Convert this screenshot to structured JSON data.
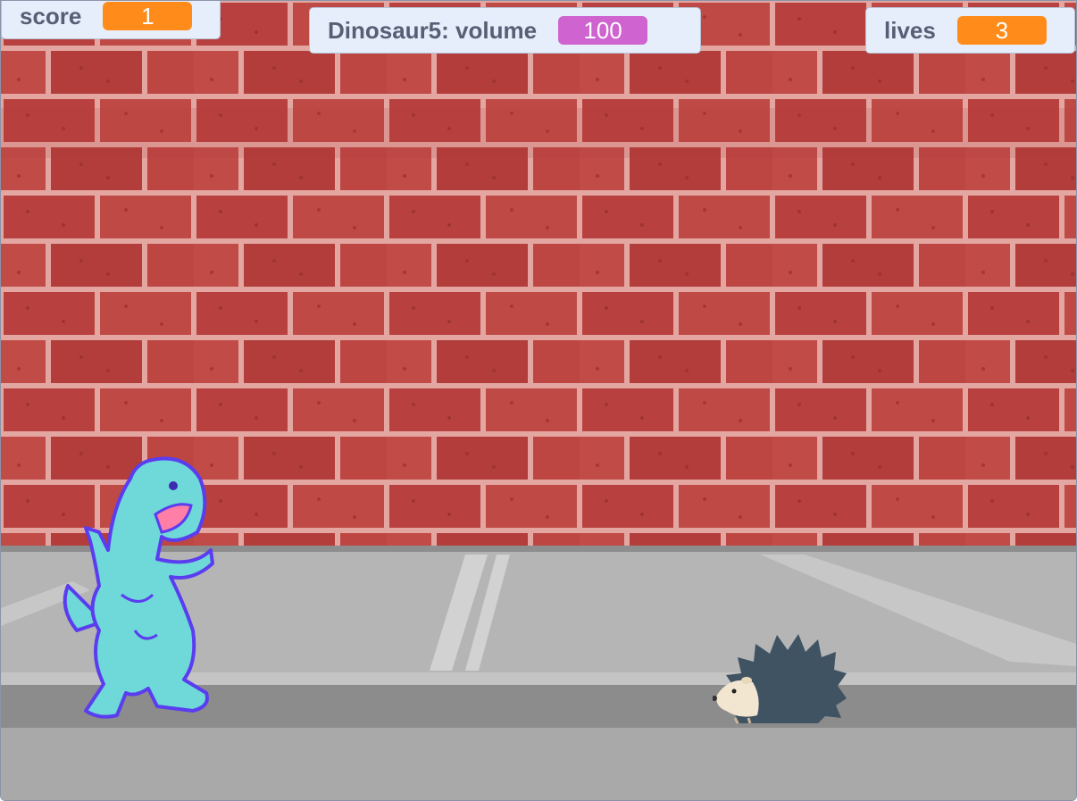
{
  "monitors": {
    "score": {
      "label": "score",
      "value": "1",
      "color": "#ff8c1a"
    },
    "volume": {
      "label": "Dinosaur5: volume",
      "value": "100",
      "color": "#cf63cf"
    },
    "lives": {
      "label": "lives",
      "value": "3",
      "color": "#ff8c1a"
    }
  },
  "colors": {
    "brick": "#b8413f",
    "mortar": "#e3a6a1",
    "sidewalk": "#b4b4b4",
    "curb": "#8c8c8c",
    "street": "#a9a9a9",
    "dinosaur": "#6fd8d8",
    "dinosaur_outline": "#5b3df0",
    "hedgehog": "#3f5363"
  },
  "sprites": {
    "dinosaur": "dinosaur-sprite",
    "hedgehog": "hedgehog-sprite"
  }
}
